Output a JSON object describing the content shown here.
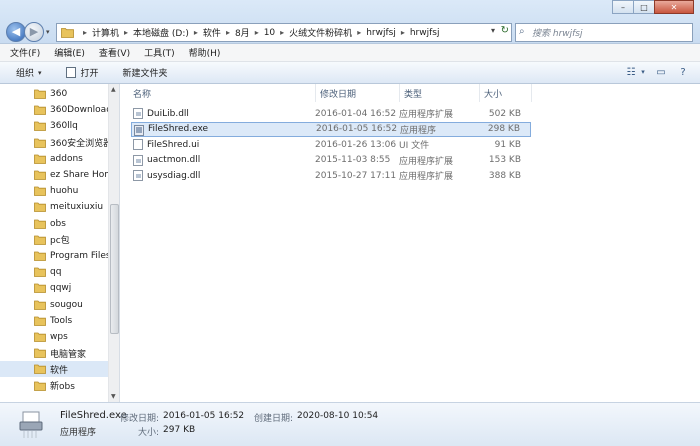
{
  "window": {
    "buttons": {
      "minimize": "–",
      "maximize": "□",
      "close": "✕"
    }
  },
  "nav": {
    "back_icon": "back-arrow-icon",
    "forward_icon": "forward-arrow-icon"
  },
  "address": {
    "breadcrumbs": [
      "计算机",
      "本地磁盘 (D:)",
      "软件",
      "8月",
      "10",
      "火绒文件粉碎机",
      "hrwjfsj",
      "hrwjfsj"
    ]
  },
  "search": {
    "placeholder": "搜索 hrwjfsj"
  },
  "menu": {
    "items": [
      "文件(F)",
      "编辑(E)",
      "查看(V)",
      "工具(T)",
      "帮助(H)"
    ]
  },
  "toolbar": {
    "organize": "组织",
    "open": "打开",
    "new_folder": "新建文件夹"
  },
  "nav_pane": {
    "items": [
      {
        "label": "360"
      },
      {
        "label": "360Downloads"
      },
      {
        "label": "360llq"
      },
      {
        "label": "360安全浏览器"
      },
      {
        "label": "addons"
      },
      {
        "label": "ez Share Home"
      },
      {
        "label": "huohu"
      },
      {
        "label": "meituxiuxiu"
      },
      {
        "label": "obs"
      },
      {
        "label": "pc包"
      },
      {
        "label": "Program Files"
      },
      {
        "label": "qq"
      },
      {
        "label": "qqwj"
      },
      {
        "label": "sougou"
      },
      {
        "label": "Tools"
      },
      {
        "label": "wps"
      },
      {
        "label": "电脑管家"
      },
      {
        "label": "软件",
        "selected": true
      },
      {
        "label": "新obs"
      }
    ]
  },
  "files": {
    "columns": {
      "name": "名称",
      "date": "修改日期",
      "type": "类型",
      "size": "大小"
    },
    "rows": [
      {
        "name": "DuiLib.dll",
        "date": "2016-01-04 16:52",
        "type": "应用程序扩展",
        "size": "502 KB",
        "kind": "dll"
      },
      {
        "name": "FileShred.exe",
        "date": "2016-01-05 16:52",
        "type": "应用程序",
        "size": "298 KB",
        "kind": "exe",
        "selected": true
      },
      {
        "name": "FileShred.ui",
        "date": "2016-01-26 13:06",
        "type": "UI 文件",
        "size": "91 KB",
        "kind": "file"
      },
      {
        "name": "uactmon.dll",
        "date": "2015-11-03 8:55",
        "type": "应用程序扩展",
        "size": "153 KB",
        "kind": "dll"
      },
      {
        "name": "usysdiag.dll",
        "date": "2015-10-27 17:11",
        "type": "应用程序扩展",
        "size": "388 KB",
        "kind": "dll"
      }
    ]
  },
  "details": {
    "name": "FileShred.exe",
    "type": "应用程序",
    "modified_label": "修改日期:",
    "modified_value": "2016-01-05 16:52",
    "created_label": "创建日期:",
    "created_value": "2020-08-10 10:54",
    "size_label": "大小:",
    "size_value": "297 KB"
  }
}
